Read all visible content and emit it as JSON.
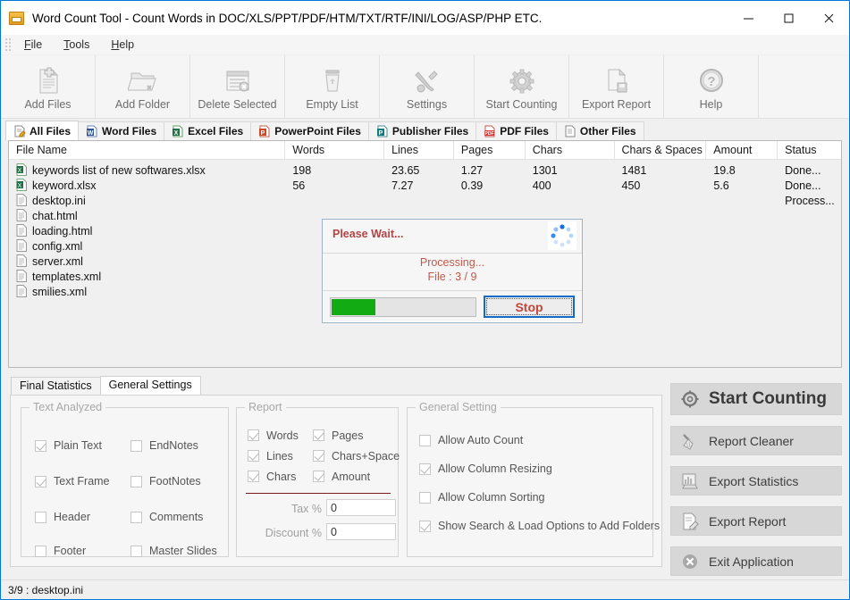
{
  "window": {
    "title": "Word Count Tool - Count Words in DOC/XLS/PPT/PDF/HTM/TXT/RTF/INI/LOG/ASP/PHP ETC.",
    "icon": "app-icon",
    "minimize": "—",
    "maximize": "□",
    "close": "✕"
  },
  "menu": {
    "items": [
      "File",
      "Tools",
      "Help"
    ]
  },
  "toolbar": {
    "buttons": [
      {
        "label": "Add Files",
        "icon": "add-file-icon"
      },
      {
        "label": "Add Folder",
        "icon": "add-folder-icon"
      },
      {
        "label": "Delete Selected",
        "icon": "delete-selected-icon"
      },
      {
        "label": "Empty List",
        "icon": "trash-icon"
      },
      {
        "label": "Settings",
        "icon": "tools-icon"
      },
      {
        "label": "Start Counting",
        "icon": "gear-icon"
      },
      {
        "label": "Export Report",
        "icon": "export-report-icon"
      },
      {
        "label": "Help",
        "icon": "help-icon"
      }
    ]
  },
  "file_tabs": [
    {
      "label": "All Files",
      "icon": "all-files-icon",
      "active": true
    },
    {
      "label": "Word Files",
      "icon": "word-icon",
      "active": false
    },
    {
      "label": "Excel Files",
      "icon": "excel-icon",
      "active": false
    },
    {
      "label": "PowerPoint Files",
      "icon": "powerpoint-icon",
      "active": false
    },
    {
      "label": "Publisher Files",
      "icon": "publisher-icon",
      "active": false
    },
    {
      "label": "PDF Files",
      "icon": "pdf-icon",
      "active": false
    },
    {
      "label": "Other Files",
      "icon": "other-file-icon",
      "active": false
    }
  ],
  "table": {
    "columns": [
      "File Name",
      "Words",
      "Lines",
      "Pages",
      "Chars",
      "Chars & Spaces",
      "Amount",
      "Status"
    ],
    "rows": [
      {
        "name": "keywords list of new softwares.xlsx",
        "icon": "excel-file-icon",
        "words": "198",
        "lines": "23.65",
        "pages": "1.27",
        "chars": "1301",
        "chars_spaces": "1481",
        "amount": "19.8",
        "status": "Done..."
      },
      {
        "name": "keyword.xlsx",
        "icon": "excel-file-icon",
        "words": "56",
        "lines": "7.27",
        "pages": "0.39",
        "chars": "400",
        "chars_spaces": "450",
        "amount": "5.6",
        "status": "Done..."
      },
      {
        "name": "desktop.ini",
        "icon": "generic-file-icon",
        "words": "",
        "lines": "",
        "pages": "",
        "chars": "",
        "chars_spaces": "",
        "amount": "",
        "status": "Process..."
      },
      {
        "name": "chat.html",
        "icon": "generic-file-icon",
        "words": "",
        "lines": "",
        "pages": "",
        "chars": "",
        "chars_spaces": "",
        "amount": "",
        "status": ""
      },
      {
        "name": "loading.html",
        "icon": "generic-file-icon",
        "words": "",
        "lines": "",
        "pages": "",
        "chars": "",
        "chars_spaces": "",
        "amount": "",
        "status": ""
      },
      {
        "name": "config.xml",
        "icon": "generic-file-icon",
        "words": "",
        "lines": "",
        "pages": "",
        "chars": "",
        "chars_spaces": "",
        "amount": "",
        "status": ""
      },
      {
        "name": "server.xml",
        "icon": "generic-file-icon",
        "words": "",
        "lines": "",
        "pages": "",
        "chars": "",
        "chars_spaces": "",
        "amount": "",
        "status": ""
      },
      {
        "name": "templates.xml",
        "icon": "generic-file-icon",
        "words": "",
        "lines": "",
        "pages": "",
        "chars": "",
        "chars_spaces": "",
        "amount": "",
        "status": ""
      },
      {
        "name": "smilies.xml",
        "icon": "generic-file-icon",
        "words": "",
        "lines": "",
        "pages": "",
        "chars": "",
        "chars_spaces": "",
        "amount": "",
        "status": ""
      }
    ]
  },
  "dialog": {
    "title": "Please Wait...",
    "status_line1": "Processing...",
    "status_line2": "File : 3 / 9",
    "progress_percent": 30,
    "stop_label": "Stop",
    "spinner_icon": "loading-spinner-icon",
    "progress_color": "#13ab13",
    "accent_color": "#c4463c"
  },
  "settings_tabs": [
    {
      "label": "Final Statistics",
      "active": false
    },
    {
      "label": "General Settings",
      "active": true
    }
  ],
  "groups": {
    "text_analyzed": {
      "title": "Text Analyzed",
      "left": [
        {
          "label": "Plain Text",
          "checked": true
        },
        {
          "label": "Text Frame",
          "checked": true
        },
        {
          "label": "Header",
          "checked": false
        },
        {
          "label": "Footer",
          "checked": false
        }
      ],
      "right": [
        {
          "label": "EndNotes",
          "checked": false
        },
        {
          "label": "FootNotes",
          "checked": false
        },
        {
          "label": "Comments",
          "checked": false
        },
        {
          "label": "Master Slides",
          "checked": false
        }
      ]
    },
    "report": {
      "title": "Report",
      "left": [
        {
          "label": "Words",
          "checked": true
        },
        {
          "label": "Lines",
          "checked": true
        },
        {
          "label": "Chars",
          "checked": true
        }
      ],
      "right": [
        {
          "label": "Pages",
          "checked": true
        },
        {
          "label": "Chars+Space",
          "checked": true
        },
        {
          "label": "Amount",
          "checked": true
        }
      ],
      "fields": [
        {
          "label": "Tax %",
          "value": "0"
        },
        {
          "label": "Discount %",
          "value": "0"
        }
      ]
    },
    "general_setting": {
      "title": "General Setting",
      "items": [
        {
          "label": "Allow Auto Count",
          "checked": false
        },
        {
          "label": "Allow Column Resizing",
          "checked": true
        },
        {
          "label": "Allow Column Sorting",
          "checked": false
        },
        {
          "label": "Show Search & Load Options to Add Folders",
          "checked": true
        }
      ]
    }
  },
  "action_buttons": [
    {
      "label": "Start Counting",
      "icon": "gear-icon",
      "primary": true
    },
    {
      "label": "Report Cleaner",
      "icon": "broom-icon",
      "primary": false
    },
    {
      "label": "Export Statistics",
      "icon": "export-statistics-icon",
      "primary": false
    },
    {
      "label": "Export Report",
      "icon": "export-report-icon",
      "primary": false
    },
    {
      "label": "Exit Application",
      "icon": "exit-icon",
      "primary": false
    }
  ],
  "statusbar": {
    "text": "3/9 : desktop.ini"
  }
}
